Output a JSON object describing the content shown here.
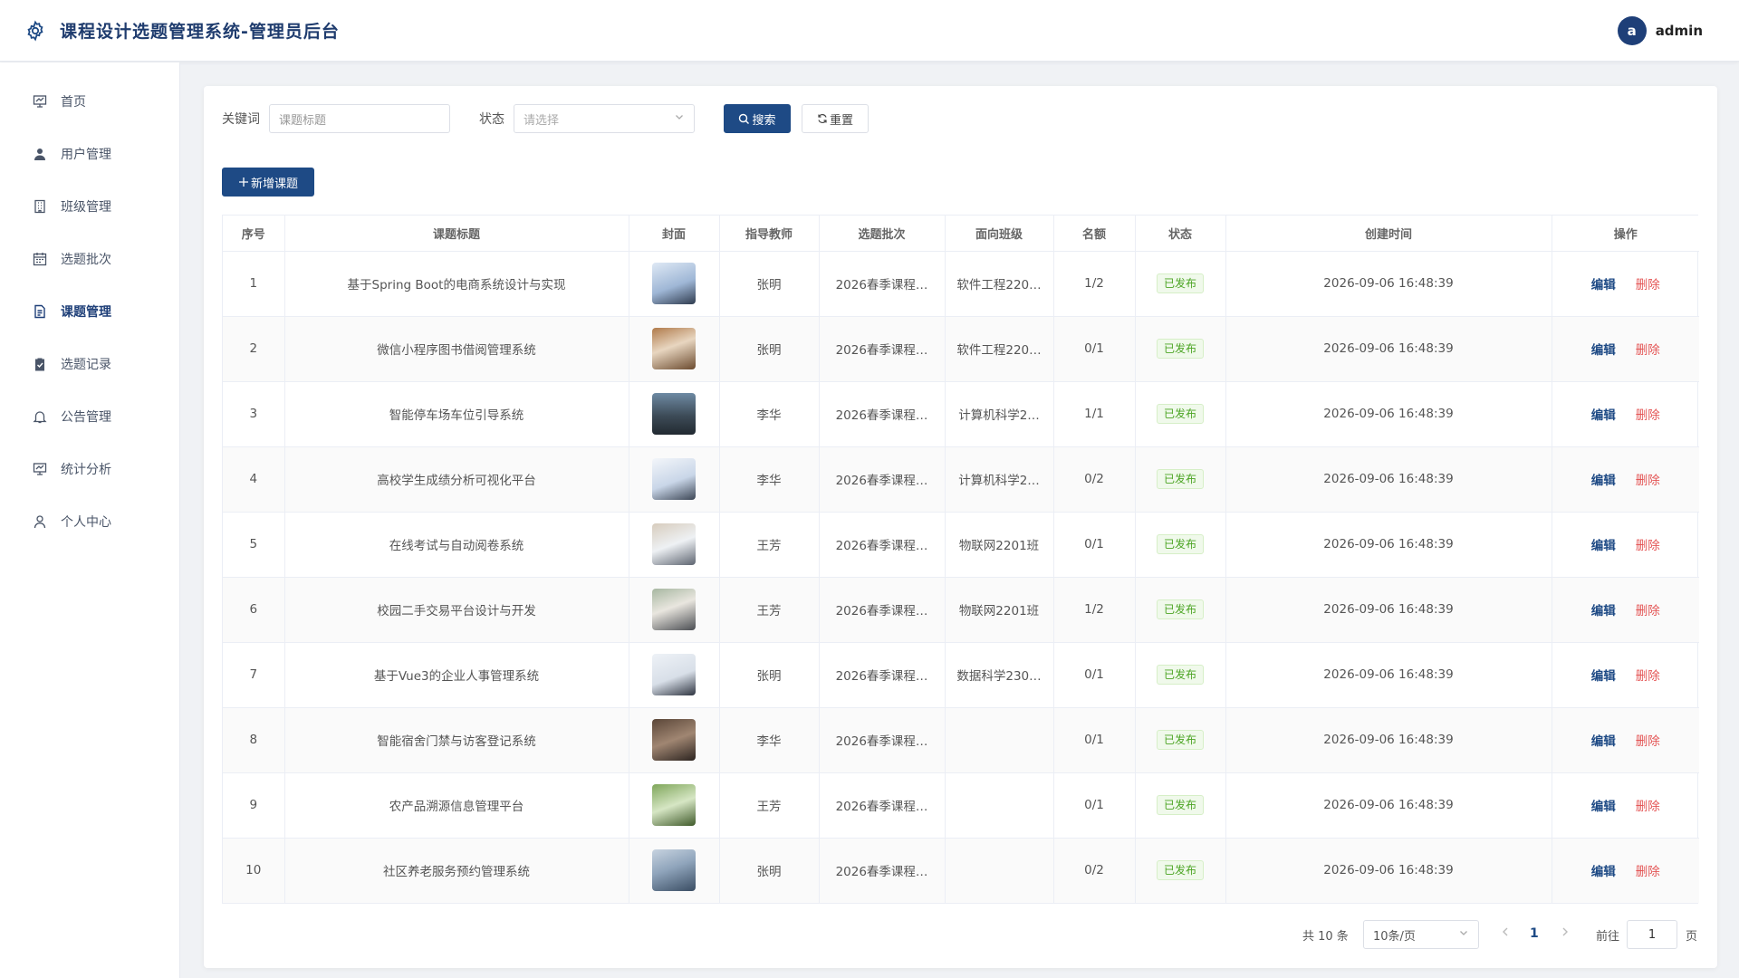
{
  "header": {
    "title": "课程设计选题管理系统-管理员后台",
    "avatar_letter": "a",
    "username": "admin"
  },
  "sidebar": {
    "items": [
      {
        "label": "首页",
        "icon": "monitor-icon"
      },
      {
        "label": "用户管理",
        "icon": "user-icon"
      },
      {
        "label": "班级管理",
        "icon": "building-icon"
      },
      {
        "label": "选题批次",
        "icon": "calendar-icon"
      },
      {
        "label": "课题管理",
        "icon": "document-icon",
        "active": true
      },
      {
        "label": "选题记录",
        "icon": "checklist-icon"
      },
      {
        "label": "公告管理",
        "icon": "bell-icon"
      },
      {
        "label": "统计分析",
        "icon": "chart-icon"
      },
      {
        "label": "个人中心",
        "icon": "person-icon"
      }
    ]
  },
  "filters": {
    "keyword_label": "关键词",
    "keyword_placeholder": "课题标题",
    "status_label": "状态",
    "status_placeholder": "请选择",
    "search_label": "搜索",
    "reset_label": "重置"
  },
  "add_button_label": "新增课题",
  "table": {
    "headers": [
      "序号",
      "课题标题",
      "封面",
      "指导教师",
      "选题批次",
      "面向班级",
      "名额",
      "状态",
      "创建时间",
      "操作"
    ],
    "rows": [
      {
        "no": "1",
        "title": "基于Spring Boot的电商系统设计与实现",
        "teacher": "张明",
        "batch": "2026春季课程…",
        "class": "软件工程220…",
        "quota": "1/2",
        "status": "已发布",
        "created": "2026-09-06 16:48:39",
        "edit": "编辑",
        "delete": "删除"
      },
      {
        "no": "2",
        "title": "微信小程序图书借阅管理系统",
        "teacher": "张明",
        "batch": "2026春季课程…",
        "class": "软件工程220…",
        "quota": "0/1",
        "status": "已发布",
        "created": "2026-09-06 16:48:39",
        "edit": "编辑",
        "delete": "删除"
      },
      {
        "no": "3",
        "title": "智能停车场车位引导系统",
        "teacher": "李华",
        "batch": "2026春季课程…",
        "class": "计算机科学2…",
        "quota": "1/1",
        "status": "已发布",
        "created": "2026-09-06 16:48:39",
        "edit": "编辑",
        "delete": "删除"
      },
      {
        "no": "4",
        "title": "高校学生成绩分析可视化平台",
        "teacher": "李华",
        "batch": "2026春季课程…",
        "class": "计算机科学2…",
        "quota": "0/2",
        "status": "已发布",
        "created": "2026-09-06 16:48:39",
        "edit": "编辑",
        "delete": "删除"
      },
      {
        "no": "5",
        "title": "在线考试与自动阅卷系统",
        "teacher": "王芳",
        "batch": "2026春季课程…",
        "class": "物联网2201班",
        "quota": "0/1",
        "status": "已发布",
        "created": "2026-09-06 16:48:39",
        "edit": "编辑",
        "delete": "删除"
      },
      {
        "no": "6",
        "title": "校园二手交易平台设计与开发",
        "teacher": "王芳",
        "batch": "2026春季课程…",
        "class": "物联网2201班",
        "quota": "1/2",
        "status": "已发布",
        "created": "2026-09-06 16:48:39",
        "edit": "编辑",
        "delete": "删除"
      },
      {
        "no": "7",
        "title": "基于Vue3的企业人事管理系统",
        "teacher": "张明",
        "batch": "2026春季课程…",
        "class": "数据科学230…",
        "quota": "0/1",
        "status": "已发布",
        "created": "2026-09-06 16:48:39",
        "edit": "编辑",
        "delete": "删除"
      },
      {
        "no": "8",
        "title": "智能宿舍门禁与访客登记系统",
        "teacher": "李华",
        "batch": "2026春季课程…",
        "class": "",
        "quota": "0/1",
        "status": "已发布",
        "created": "2026-09-06 16:48:39",
        "edit": "编辑",
        "delete": "删除"
      },
      {
        "no": "9",
        "title": "农产品溯源信息管理平台",
        "teacher": "王芳",
        "batch": "2026春季课程…",
        "class": "",
        "quota": "0/1",
        "status": "已发布",
        "created": "2026-09-06 16:48:39",
        "edit": "编辑",
        "delete": "删除"
      },
      {
        "no": "10",
        "title": "社区养老服务预约管理系统",
        "teacher": "张明",
        "batch": "2026春季课程…",
        "class": "",
        "quota": "0/2",
        "status": "已发布",
        "created": "2026-09-06 16:48:39",
        "edit": "编辑",
        "delete": "删除"
      }
    ]
  },
  "pagination": {
    "total": "共 10 条",
    "page_size": "10条/页",
    "current_page": "1",
    "goto_label": "前往",
    "goto_value": "1",
    "page_suffix": "页"
  },
  "colors": {
    "primary": "#1e4a85",
    "danger": "#e45656",
    "success": "#4ca524"
  }
}
